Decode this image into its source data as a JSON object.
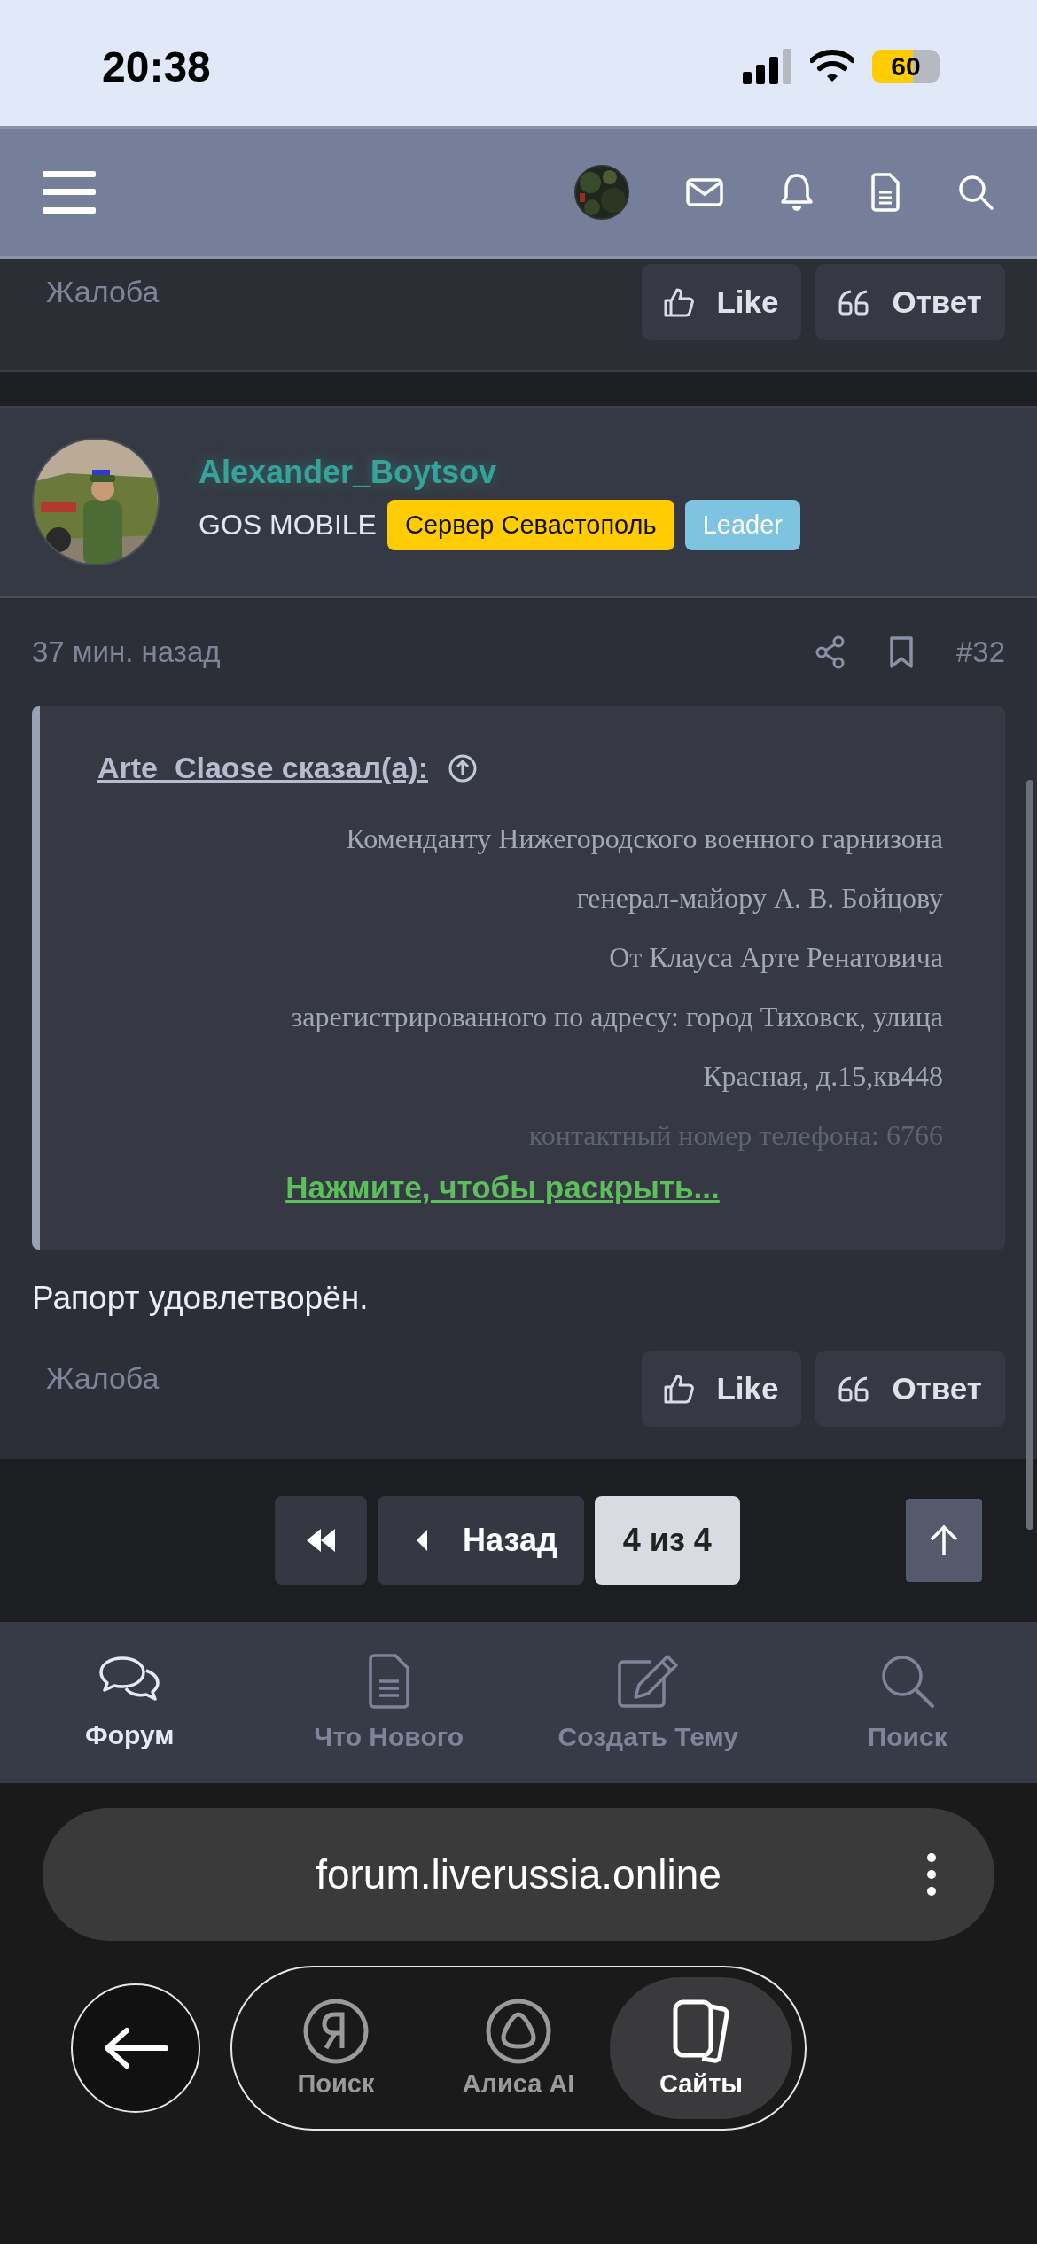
{
  "status_bar": {
    "time": "20:38",
    "battery": "60"
  },
  "prev_post": {
    "report": "Жалоба",
    "actions": [
      "Like",
      "Ответ"
    ]
  },
  "post": {
    "author": "Alexander_Boytsov",
    "group": "GOS MOBILE",
    "badges": [
      {
        "label": "Сервер Севастополь",
        "color": "#ffcc00"
      },
      {
        "label": "Leader",
        "color": "#7ec3e0"
      }
    ],
    "time": "37 мин. назад",
    "number": "#32",
    "quote": {
      "author_link": "Arte_Claose сказал(а):",
      "expanded": false,
      "lines": [
        "Коменданту Нижегородского военного гарнизона",
        "генерал-майору А. В. Бойцову",
        "От Клауса Арте Ренатовича",
        "зарегистрированного по адресу: город Тиховск, улица",
        "Красная, д.15,кв448",
        "контактный номер телефона: 6766"
      ],
      "expand_link": "Нажмите, чтобы раскрыть..."
    },
    "body": "Рапорт удовлетворён.",
    "report": "Жалоба",
    "actions": [
      "Like",
      "Ответ"
    ]
  },
  "pagination": {
    "back": "Назад",
    "page": "4 из 4"
  },
  "bottom_nav": [
    {
      "label": "Форум",
      "selected": true
    },
    {
      "label": "Что Нового",
      "selected": false
    },
    {
      "label": "Создать Тему",
      "selected": false
    },
    {
      "label": "Поиск",
      "selected": false
    }
  ],
  "browser": {
    "url": "forum.liverussia.online",
    "tabs": [
      {
        "label": "Поиск",
        "selected": false
      },
      {
        "label": "Алиса AI",
        "selected": false
      },
      {
        "label": "Сайты",
        "selected": true
      }
    ]
  }
}
